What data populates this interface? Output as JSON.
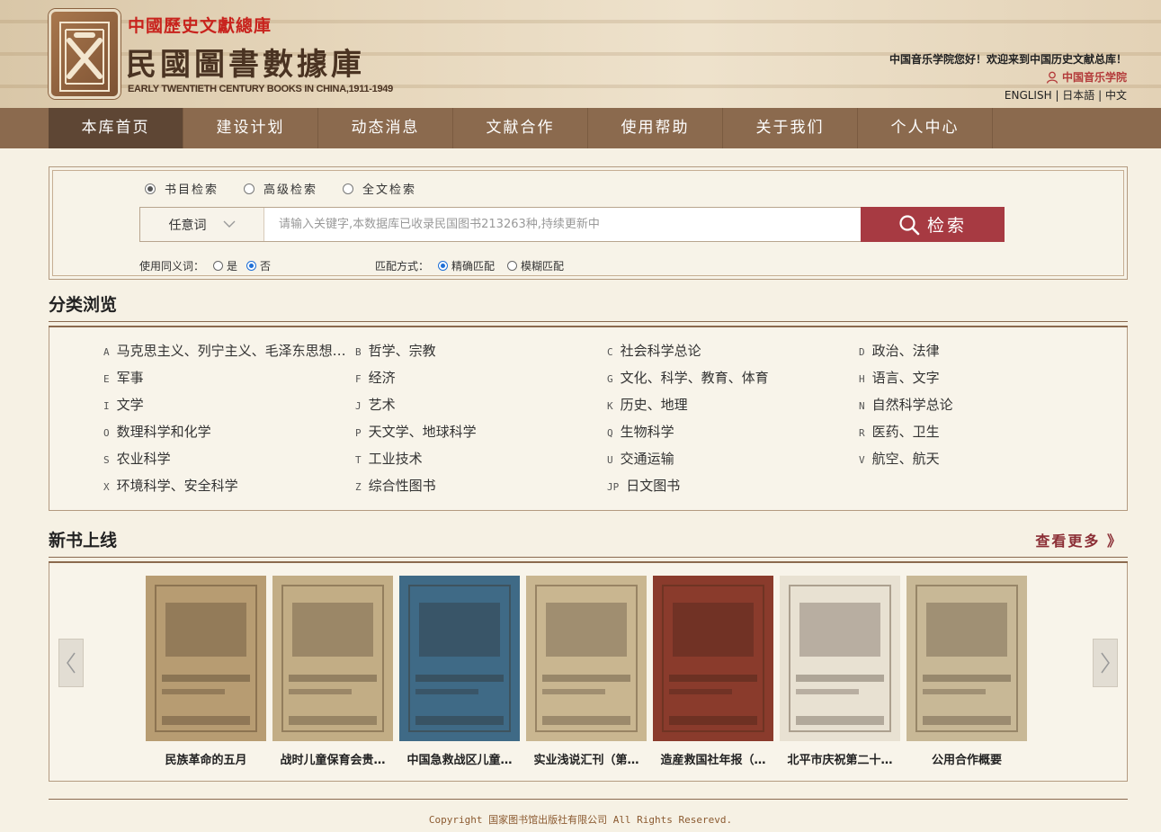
{
  "header": {
    "super_title": "中國歷史文獻總庫",
    "title": "民國圖書數據庫",
    "subtitle_en": "EARLY TWENTIETH CENTURY BOOKS IN CHINA,1911-1949",
    "welcome": "中国音乐学院您好！欢迎来到中国历史文献总库！",
    "user": "中国音乐学院",
    "lang_en": "ENGLISH",
    "lang_ja": "日本語",
    "lang_zh": "中文"
  },
  "nav": [
    "本库首页",
    "建设计划",
    "动态消息",
    "文献合作",
    "使用帮助",
    "关于我们",
    "个人中心"
  ],
  "search": {
    "modes": [
      "书目检索",
      "高级检索",
      "全文检索"
    ],
    "selected_mode": "书目检索",
    "scope": "任意词",
    "placeholder": "请输入关键字,本数据库已收录民国图书213263种,持续更新中",
    "button": "检索",
    "synonym_label": "使用同义词：",
    "synonym_yes": "是",
    "synonym_no": "否",
    "synonym_selected": "否",
    "match_label": "匹配方式：",
    "match_exact": "精确匹配",
    "match_fuzzy": "模糊匹配",
    "match_selected": "精确匹配"
  },
  "categories": {
    "title": "分类浏览",
    "items": [
      {
        "code": "A",
        "label": "马克思主义、列宁主义、毛泽东思想…"
      },
      {
        "code": "B",
        "label": "哲学、宗教"
      },
      {
        "code": "C",
        "label": "社会科学总论"
      },
      {
        "code": "D",
        "label": "政治、法律"
      },
      {
        "code": "E",
        "label": "军事"
      },
      {
        "code": "F",
        "label": "经济"
      },
      {
        "code": "G",
        "label": "文化、科学、教育、体育"
      },
      {
        "code": "H",
        "label": "语言、文字"
      },
      {
        "code": "I",
        "label": "文学"
      },
      {
        "code": "J",
        "label": "艺术"
      },
      {
        "code": "K",
        "label": "历史、地理"
      },
      {
        "code": "N",
        "label": "自然科学总论"
      },
      {
        "code": "O",
        "label": "数理科学和化学"
      },
      {
        "code": "P",
        "label": "天文学、地球科学"
      },
      {
        "code": "Q",
        "label": "生物科学"
      },
      {
        "code": "R",
        "label": "医药、卫生"
      },
      {
        "code": "S",
        "label": "农业科学"
      },
      {
        "code": "T",
        "label": "工业技术"
      },
      {
        "code": "U",
        "label": "交通运输"
      },
      {
        "code": "V",
        "label": "航空、航天"
      },
      {
        "code": "X",
        "label": "环境科学、安全科学"
      },
      {
        "code": "Z",
        "label": "综合性图书"
      },
      {
        "code": "JP",
        "label": "日文图书"
      }
    ]
  },
  "new_books": {
    "title": "新书上线",
    "more": "查看更多 》",
    "items": [
      {
        "title": "民族革命的五月",
        "color": "#b79c72"
      },
      {
        "title": "战时儿童保育会贵…",
        "color": "#c2ad85"
      },
      {
        "title": "中国急救战区儿童…",
        "color": "#3f6a86"
      },
      {
        "title": "实业浅说汇刊（第…",
        "color": "#c9b690"
      },
      {
        "title": "造産救国社年报（…",
        "color": "#8a3b2c"
      },
      {
        "title": "北平市庆祝第二十…",
        "color": "#e8e1d2"
      },
      {
        "title": "公用合作概要",
        "color": "#c8b896"
      }
    ]
  },
  "footer": "Copyright 国家图书馆出版社有限公司 All Rights Reserevd."
}
